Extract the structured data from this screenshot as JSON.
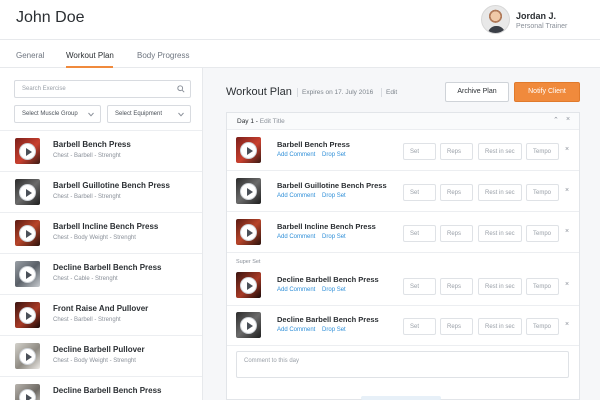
{
  "header": {
    "client_name": "John Doe",
    "trainer_name": "Jordan J.",
    "trainer_role": "Personal Trainer"
  },
  "tabs": [
    {
      "label": "General",
      "active": false
    },
    {
      "label": "Workout Plan",
      "active": true
    },
    {
      "label": "Body Progress",
      "active": false
    }
  ],
  "accent_color": "#f08a3c",
  "link_color": "#2f8fd8",
  "library": {
    "search_placeholder": "Search Exercise",
    "muscle_group_select": "Select Muscle Group",
    "equipment_select": "Select Equipment",
    "exercises": [
      {
        "name": "Barbell Bench Press",
        "meta": "Chest - Barbell - Strenght"
      },
      {
        "name": "Barbell Guillotine Bench Press",
        "meta": "Chest - Barbell - Strenght"
      },
      {
        "name": "Barbell Incline Bench Press",
        "meta": "Chest - Body Weight - Strenght"
      },
      {
        "name": "Decline Barbell Bench Press",
        "meta": "Chest - Cable - Strenght"
      },
      {
        "name": "Front Raise And Pullover",
        "meta": "Chest - Barbell - Strenght"
      },
      {
        "name": "Decline Barbell Pullover",
        "meta": "Chest - Body Weight - Strenght"
      },
      {
        "name": "Decline Barbell Bench Press",
        "meta": ""
      }
    ]
  },
  "plan": {
    "title": "Workout Plan",
    "expires": "Expires on 17. July 2016",
    "edit_label": "Edit",
    "archive_label": "Archive Plan",
    "notify_label": "Notify Client",
    "day_title": "Day 1",
    "day_edit": "Edit Title",
    "superset_label": "Super Set",
    "comment_placeholder": "Comment to this day",
    "add_comment": "Add Comment",
    "drop_set": "Drop Set",
    "field_set": "Set",
    "field_reps": "Reps",
    "field_rest": "Rest in sec",
    "field_tempo": "Tempo",
    "rows": [
      {
        "name": "Barbell Bench Press"
      },
      {
        "name": "Barbell Guillotine Bench Press"
      },
      {
        "name": "Barbell Incline Bench Press"
      },
      {
        "name": "Decline Barbell Bench Press"
      },
      {
        "name": "Decline Barbell Bench Press"
      }
    ]
  },
  "icons": {
    "search": "search-icon",
    "chevron": "chevron-down-icon",
    "play": "play-icon",
    "close": "close-icon",
    "collapse": "chevron-up-icon"
  }
}
